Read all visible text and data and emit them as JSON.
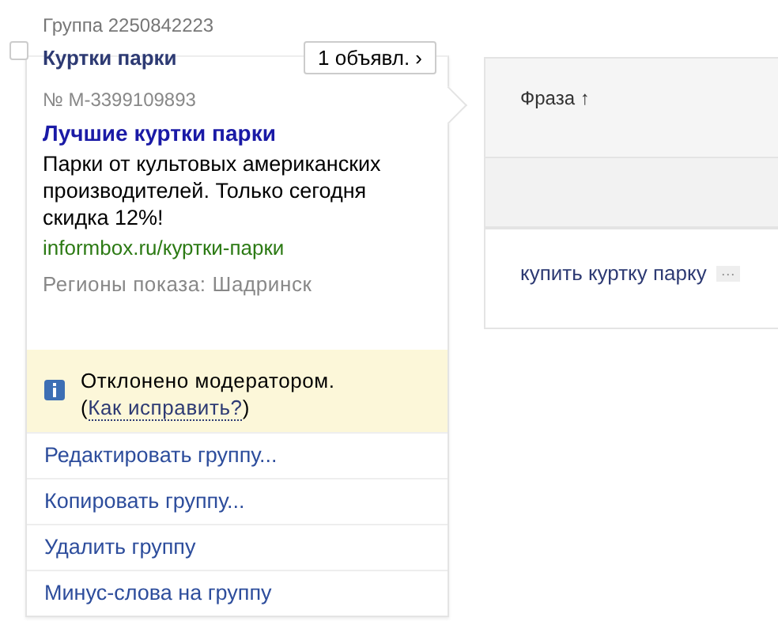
{
  "group": {
    "label": "Группа 2250842223",
    "checked": false,
    "name": "Куртки парки",
    "ads_button": "1 объявл.",
    "ads_button_icon": "›"
  },
  "ad": {
    "number": "№ M-3399109893",
    "title": "Лучшие куртки парки",
    "text": "Парки от культовых американских производителей. Только сегодня скидка 12%!",
    "url": "informbox.ru/куртки-парки",
    "regions": "Регионы показа: Шадринск"
  },
  "notice": {
    "text": "Отклонено модератором.",
    "link_open": "(",
    "link": "Как исправить?",
    "link_close": ")"
  },
  "actions": [
    "Редактировать группу...",
    "Копировать группу...",
    "Удалить группу",
    "Минус-слова на группу"
  ],
  "table": {
    "columns": [
      {
        "label": "Фраза ↑"
      }
    ],
    "rows": [
      {
        "phrase": "купить куртку парку",
        "more": "···"
      }
    ]
  }
}
